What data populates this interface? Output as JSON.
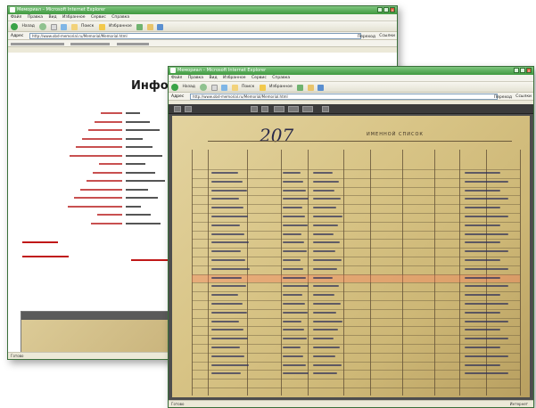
{
  "back_window": {
    "title": "Мемориал – Microsoft Internet Explorer",
    "menu": [
      "Файл",
      "Правка",
      "Вид",
      "Избранное",
      "Сервис",
      "Справка"
    ],
    "toolbar": {
      "back": "Назад",
      "search": "Поиск",
      "favorites": "Избранное"
    },
    "address_label": "Адрес",
    "address": "http://www.obd-memorial.ru/Memorial/Memorial.html",
    "go": "Переход",
    "links": "Ссылки",
    "title_text": "Информ... потеря...",
    "status": "Готово"
  },
  "front_window": {
    "title": "Мемориал – Microsoft Internet Explorer",
    "menu": [
      "Файл",
      "Правка",
      "Вид",
      "Избранное",
      "Сервис",
      "Справка"
    ],
    "toolbar": {
      "back": "Назад",
      "search": "Поиск",
      "favorites": "Избранное"
    },
    "address_label": "Адрес",
    "address": "http://www.obd-memorial.ru/Memorial/Memorial.html",
    "go": "Переход",
    "links": "Ссылки",
    "document": {
      "number": "207",
      "heading": "ИМЕННОЙ СПИСОК"
    },
    "status": "Готово",
    "zone": "Интернет"
  },
  "colors": {
    "title_green": "#3f9a3f",
    "label_red": "#b01b1b",
    "highlight_row": "#ff785a"
  }
}
